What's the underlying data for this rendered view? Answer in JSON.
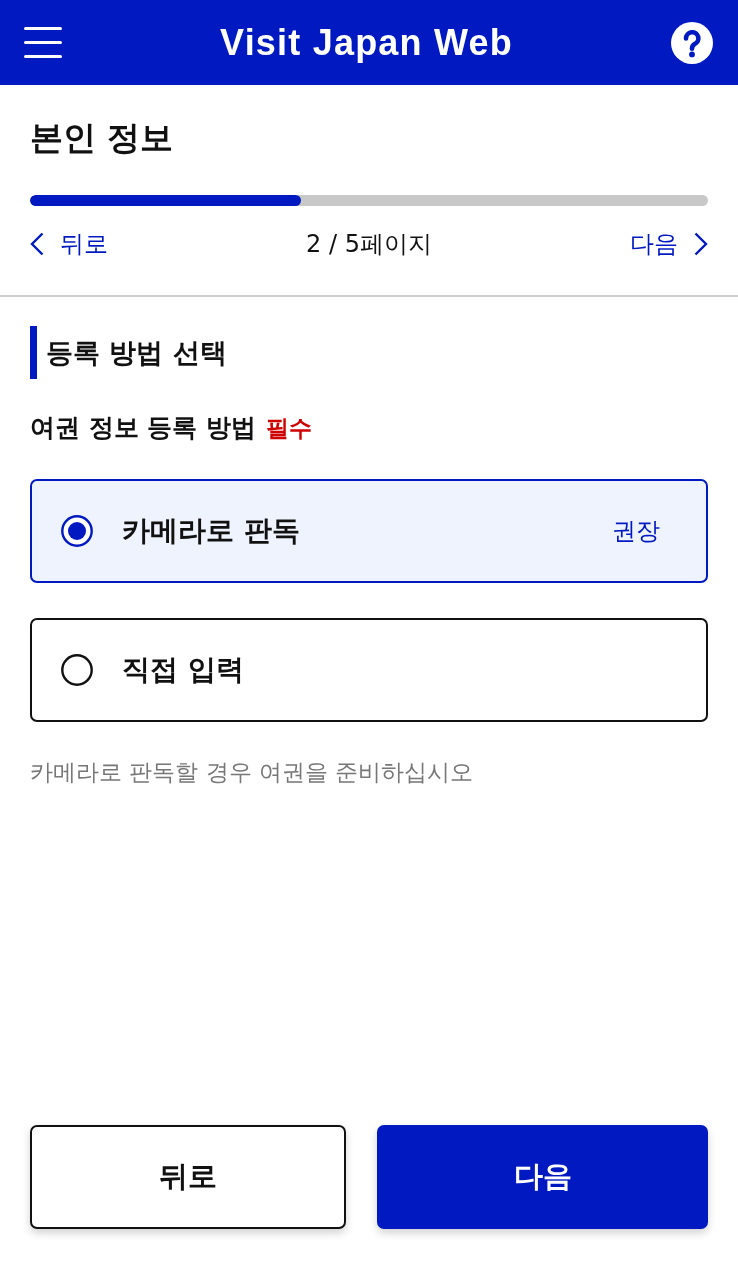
{
  "header": {
    "title": "Visit Japan Web"
  },
  "page": {
    "title": "본인 정보",
    "progress": {
      "level": 0.4
    },
    "nav": {
      "back": "뒤로",
      "page_indicator": "2 / 5페이지",
      "next": "다음"
    }
  },
  "section": {
    "heading": "등록 방법 선택",
    "field": {
      "label": "여권 정보 등록 방법",
      "required_tag": "필수",
      "options": [
        {
          "label": "카메라로 판독",
          "badge": "권장",
          "selected": true
        },
        {
          "label": "직접 입력",
          "selected": false
        }
      ],
      "hint": "카메라로 판독할 경우 여권을 준비하십시오"
    }
  },
  "footer": {
    "buttons": [
      {
        "label": "뒤로",
        "kind": "secondary"
      },
      {
        "label": "다음",
        "kind": "primary"
      }
    ]
  }
}
